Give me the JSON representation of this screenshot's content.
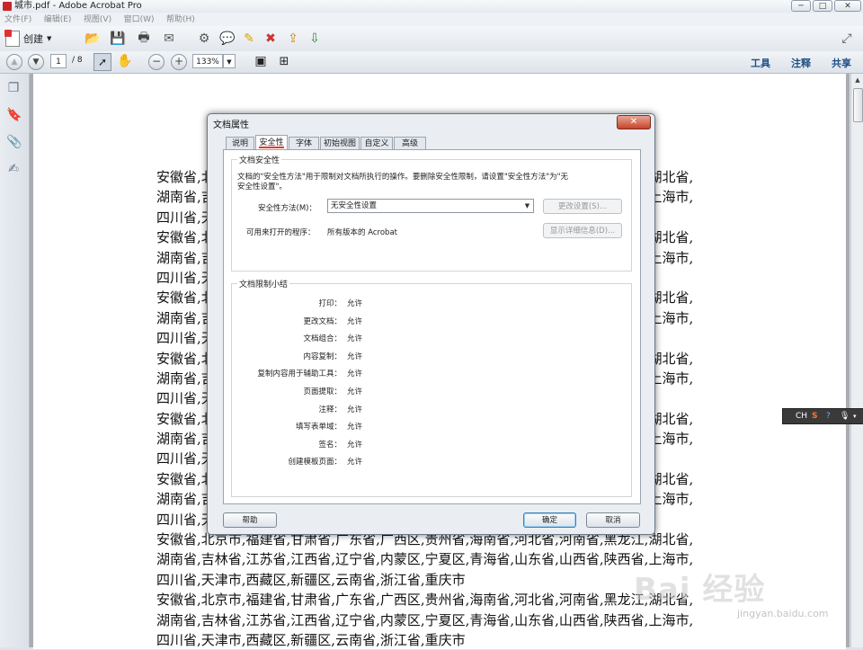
{
  "window": {
    "title": "城市.pdf - Adobe Acrobat Pro",
    "controls": [
      "─",
      "□",
      "✕"
    ]
  },
  "menubar": [
    "文件(F)",
    "编辑(E)",
    "视图(V)",
    "窗口(W)",
    "帮助(H)"
  ],
  "toolbar": {
    "create_label": "创建",
    "icons": [
      "open-folder-icon",
      "save-icon",
      "print-icon",
      "email-icon",
      "gear-icon",
      "comment-icon",
      "highlight-icon",
      "sign-icon",
      "export-icon",
      "share-icon"
    ]
  },
  "navbar": {
    "page_current": "1",
    "page_total": "/ 8",
    "zoom": "133%",
    "tools_label": "工具",
    "comment_label": "注释",
    "share_label": "共享"
  },
  "document": {
    "lines": [
      "安徽省,北京市,福建省,甘肃省,广东省,广西区,贵州省,海南省,河北省,河南省,黑龙江,湖北省,",
      "湖南省,吉林省,江苏省,江西省,辽宁省,内蒙区,宁夏区,青海省,山东省,山西省,陕西省,上海市,",
      "四川省,天津市,西藏区,新疆区,云南省,浙江省,重庆市",
      "安徽省,北京市,福建省,甘肃省,广东省,广西区,贵州省,海南省,河北省,河南省,黑龙江,湖北省,",
      "湖南省,吉林省,江苏省,江西省,辽宁省,内蒙区,宁夏区,青海省,山东省,山西省,陕西省,上海市,",
      "四川省,天津市,西藏区,新疆区,云南省,浙江省,重庆市",
      "安徽省,北京市,福建省,甘肃省,广东省,广西区,贵州省,海南省,河北省,河南省,黑龙江,湖北省,",
      "湖南省,吉林省,江苏省,江西省,辽宁省,内蒙区,宁夏区,青海省,山东省,山西省,陕西省,上海市,",
      "四川省,天津市,西藏区,新疆区,云南省,浙江省,重庆市",
      "安徽省,北京市,福建省,甘肃省,广东省,广西区,贵州省,海南省,河北省,河南省,黑龙江,湖北省,",
      "湖南省,吉林省,江苏省,江西省,辽宁省,内蒙区,宁夏区,青海省,山东省,山西省,陕西省,上海市,",
      "四川省,天津市,西藏区,新疆区,云南省,浙江省,重庆市",
      "安徽省,北京市,福建省,甘肃省,广东省,广西区,贵州省,海南省,河北省,河南省,黑龙江,湖北省,",
      "湖南省,吉林省,江苏省,江西省,辽宁省,内蒙区,宁夏区,青海省,山东省,山西省,陕西省,上海市,",
      "四川省,天津市,西藏区,新疆区,云南省,浙江省,重庆市",
      "安徽省,北京市,福建省,甘肃省,广东省,广西区,贵州省,海南省,河北省,河南省,黑龙江,湖北省,",
      "湖南省,吉林省,江苏省,江西省,辽宁省,内蒙区,宁夏区,青海省,山东省,山西省,陕西省,上海市,",
      "四川省,天津市,西藏区,新疆区,云南省,浙江省,重庆市",
      "安徽省,北京市,福建省,甘肃省,广东省,广西区,贵州省,海南省,河北省,河南省,黑龙江,湖北省,",
      "湖南省,吉林省,江苏省,江西省,辽宁省,内蒙区,宁夏区,青海省,山东省,山西省,陕西省,上海市,",
      "四川省,天津市,西藏区,新疆区,云南省,浙江省,重庆市",
      "安徽省,北京市,福建省,甘肃省,广东省,广西区,贵州省,海南省,河北省,河南省,黑龙江,湖北省,",
      "湖南省,吉林省,江苏省,江西省,辽宁省,内蒙区,宁夏区,青海省,山东省,山西省,陕西省,上海市,",
      "四川省,天津市,西藏区,新疆区,云南省,浙江省,重庆市"
    ]
  },
  "dialog": {
    "title": "文档属性",
    "close": "✕",
    "tabs": [
      "说明",
      "安全性",
      "字体",
      "初始视图",
      "自定义",
      "高级"
    ],
    "active_tab": "安全性",
    "security_group": {
      "title": "文档安全性",
      "description_line1": "文档的\"安全性方法\"用于限制对文档所执行的操作。要删除安全性限制，请设置\"安全性方法\"为\"无",
      "description_line2": "安全性设置\"。",
      "method_label": "安全性方法(M)：",
      "method_value": "无安全性设置",
      "change_button": "更改设置(S)...",
      "open_with_label": "可用来打开的程序：",
      "open_with_value": "所有版本的 Acrobat",
      "details_button": "显示详细信息(D)..."
    },
    "summary_group": {
      "title": "文档限制小结",
      "rows": [
        {
          "key": "打印：",
          "value": "允许"
        },
        {
          "key": "更改文档：",
          "value": "允许"
        },
        {
          "key": "文档组合：",
          "value": "允许"
        },
        {
          "key": "内容复制：",
          "value": "允许"
        },
        {
          "key": "复制内容用于辅助工具：",
          "value": "允许"
        },
        {
          "key": "页面提取：",
          "value": "允许"
        },
        {
          "key": "注释：",
          "value": "允许"
        },
        {
          "key": "填写表单域：",
          "value": "允许"
        },
        {
          "key": "签名：",
          "value": "允许"
        },
        {
          "key": "创建模板页面：",
          "value": "允许"
        }
      ]
    },
    "help_button": "帮助",
    "ok_button": "确定",
    "cancel_button": "取消"
  },
  "ime": {
    "label": "CH"
  },
  "watermark": {
    "text": "Bai 经验",
    "url": "jingyan.baidu.com"
  }
}
